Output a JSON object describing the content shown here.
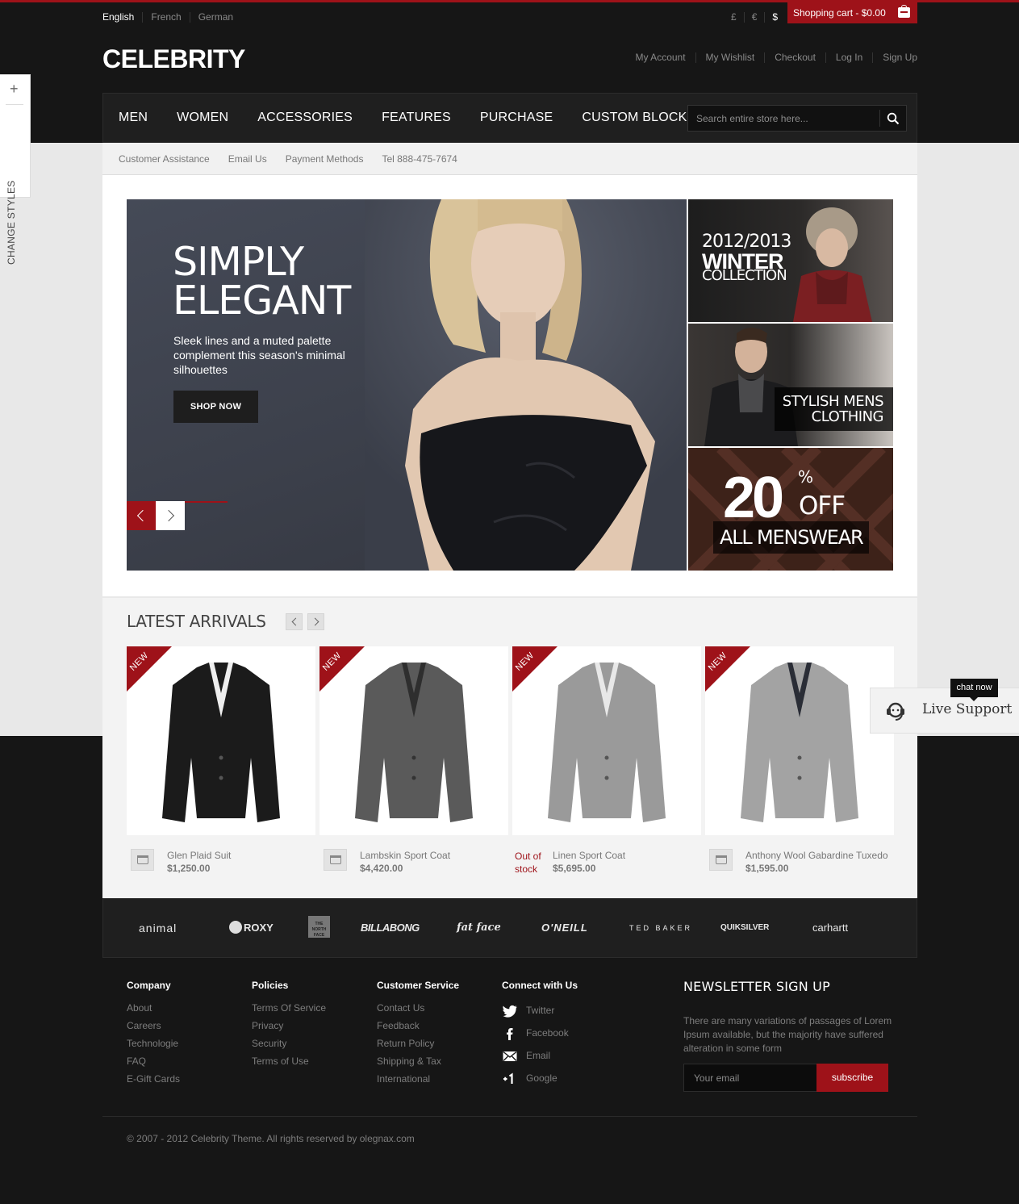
{
  "languages": [
    "English",
    "French",
    "German"
  ],
  "currencies": [
    "£",
    "€",
    "$"
  ],
  "cart_label": "Shopping cart - $0.00",
  "logo": "CELEBRITY",
  "account_links": [
    "My Account",
    "My Wishlist",
    "Checkout",
    "Log In",
    "Sign Up"
  ],
  "nav": [
    "MEN",
    "WOMEN",
    "ACCESSORIES",
    "FEATURES",
    "PURCHASE",
    "CUSTOM BLOCK"
  ],
  "search": {
    "placeholder": "Search entire store here..."
  },
  "subnav": [
    "Customer Assistance",
    "Email Us",
    "Payment Methods",
    "Tel 888-475-7674"
  ],
  "style_tab": {
    "label": "CHANGE STYLES",
    "plus": "+"
  },
  "hero": {
    "line1": "SIMPLY",
    "line2": "ELEGANT",
    "text": "Sleek lines and a muted palette complement this season's minimal silhouettes",
    "button": "SHOP NOW"
  },
  "banners": {
    "winter": {
      "year": "2012/2013",
      "title": "WINTER",
      "sub": "COLLECTION"
    },
    "mens": {
      "line1": "STYLISH MENS",
      "line2": "CLOTHING"
    },
    "sale": {
      "number": "20",
      "percent": "%",
      "off": "OFF",
      "text": "ALL MENSWEAR"
    }
  },
  "arrivals": {
    "title": "LATEST ARRIVALS",
    "badge": "NEW",
    "out_of_stock": "Out of stock",
    "products": [
      {
        "name": "Glen Plaid Suit",
        "price": "$1,250.00",
        "color": "#1b1b1b"
      },
      {
        "name": "Lambskin Sport Coat",
        "price": "$4,420.00",
        "color": "#5a5a5a"
      },
      {
        "name": "Linen Sport Coat",
        "price": "$5,695.00",
        "color": "#9a9a9a"
      },
      {
        "name": "Anthony Wool Gabardine Tuxedo",
        "price": "$1,595.00",
        "color": "#a3a3a3"
      }
    ]
  },
  "live_support": {
    "chat": "chat now",
    "label": "Live Support"
  },
  "brands": [
    "animal",
    "ROXY",
    "THE NORTH FACE",
    "BILLABONG",
    "fat face",
    "O'NEILL",
    "TED BAKER",
    "QUIKSILVER",
    "carhartt"
  ],
  "footer": {
    "company": {
      "title": "Company",
      "links": [
        "About",
        "Careers",
        "Technologie",
        "FAQ",
        "E-Gift Cards"
      ]
    },
    "policies": {
      "title": "Policies",
      "links": [
        "Terms Of Service",
        "Privacy",
        "Security",
        "Terms of Use"
      ]
    },
    "service": {
      "title": "Customer Service",
      "links": [
        "Contact Us",
        "Feedback",
        "Return Policy",
        "Shipping & Tax",
        "International"
      ]
    },
    "connect": {
      "title": "Connect with Us",
      "links": [
        "Twitter",
        "Facebook",
        "Email",
        "Google"
      ]
    },
    "newsletter": {
      "title": "NEWSLETTER SIGN UP",
      "text": "There are many variations of passages of Lorem Ipsum available, but the majority have suffered alteration in some form",
      "placeholder": "Your email",
      "button": "subscribe"
    },
    "copyright": "© 2007 - 2012 Celebrity Theme. All rights reserved by olegnax.com"
  },
  "colors": {
    "accent": "#9e1219",
    "dark": "#161616"
  }
}
